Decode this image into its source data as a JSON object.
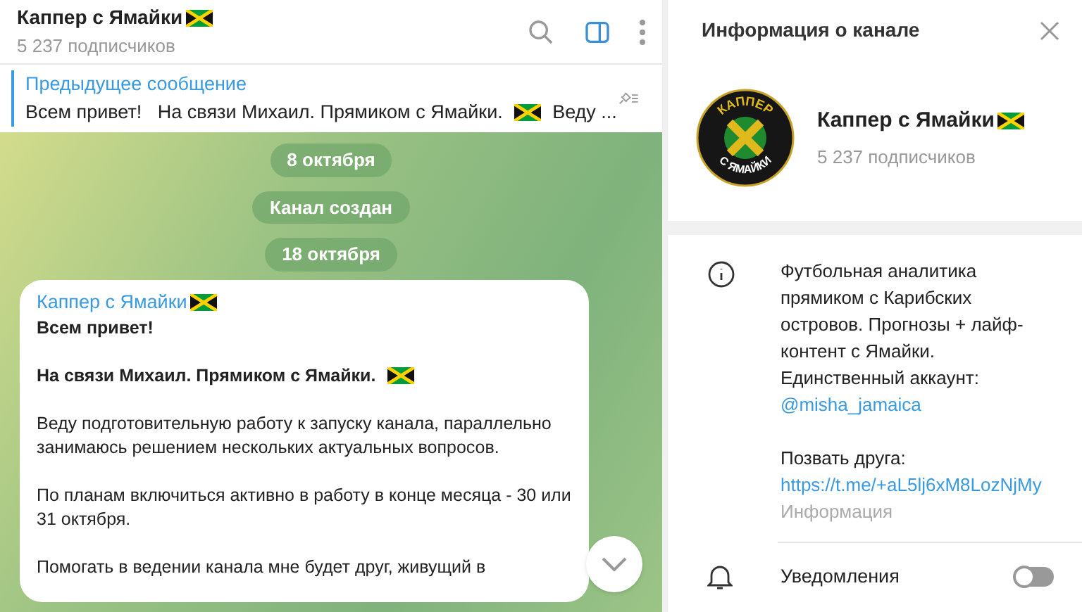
{
  "chat_header": {
    "title": "Каппер с Ямайки",
    "title_flag": true,
    "subtitle": "5 237 подписчиков",
    "side_panel_open": true
  },
  "pinned": {
    "label": "Предыдущее сообщение",
    "text_before": "Всем привет!   На связи Михаил. Прямиком с Ямайки.",
    "text_after": "Веду ..."
  },
  "service_messages": [
    "8 октября",
    "Канал создан",
    "18 октября"
  ],
  "message": {
    "author": "Каппер с Ямайки",
    "author_flag": true,
    "paragraphs": [
      {
        "text": "Всем привет!",
        "bold": true,
        "flag": false
      },
      {
        "text": "На связи Михаил. Прямиком с Ямайки.",
        "bold": true,
        "flag": true
      },
      {
        "text": "Веду подготовительную работу к запуску канала, параллельно занимаюсь решением нескольких актуальных вопросов.",
        "bold": false,
        "flag": false
      },
      {
        "text": "По планам включиться активно в работу в конце месяца - 30 или 31 октября.",
        "bold": false,
        "flag": false
      },
      {
        "text": "Помогать в ведении канала мне будет друг, живущий в",
        "bold": false,
        "flag": false
      }
    ]
  },
  "info_panel": {
    "title": "Информация о канале",
    "avatar": {
      "top_text": "КАППЕР",
      "bottom_text": "С ЯМАЙКИ"
    },
    "name": "Каппер с Ямайки",
    "name_flag": true,
    "subscribers": "5 237 подписчиков",
    "description_lines": [
      "Футбольная аналитика",
      "прямиком с Карибских",
      "островов. Прогнозы + лайф-",
      "контент с Ямайки.",
      "Единственный аккаунт:"
    ],
    "account_link": "@misha_jamaica",
    "invite_label": "Позвать друга:",
    "invite_link": "https://t.me/+aL5lj6xM8LozNjMy",
    "info_caption": "Информация",
    "notifications": {
      "label": "Уведомления",
      "on": false
    }
  }
}
